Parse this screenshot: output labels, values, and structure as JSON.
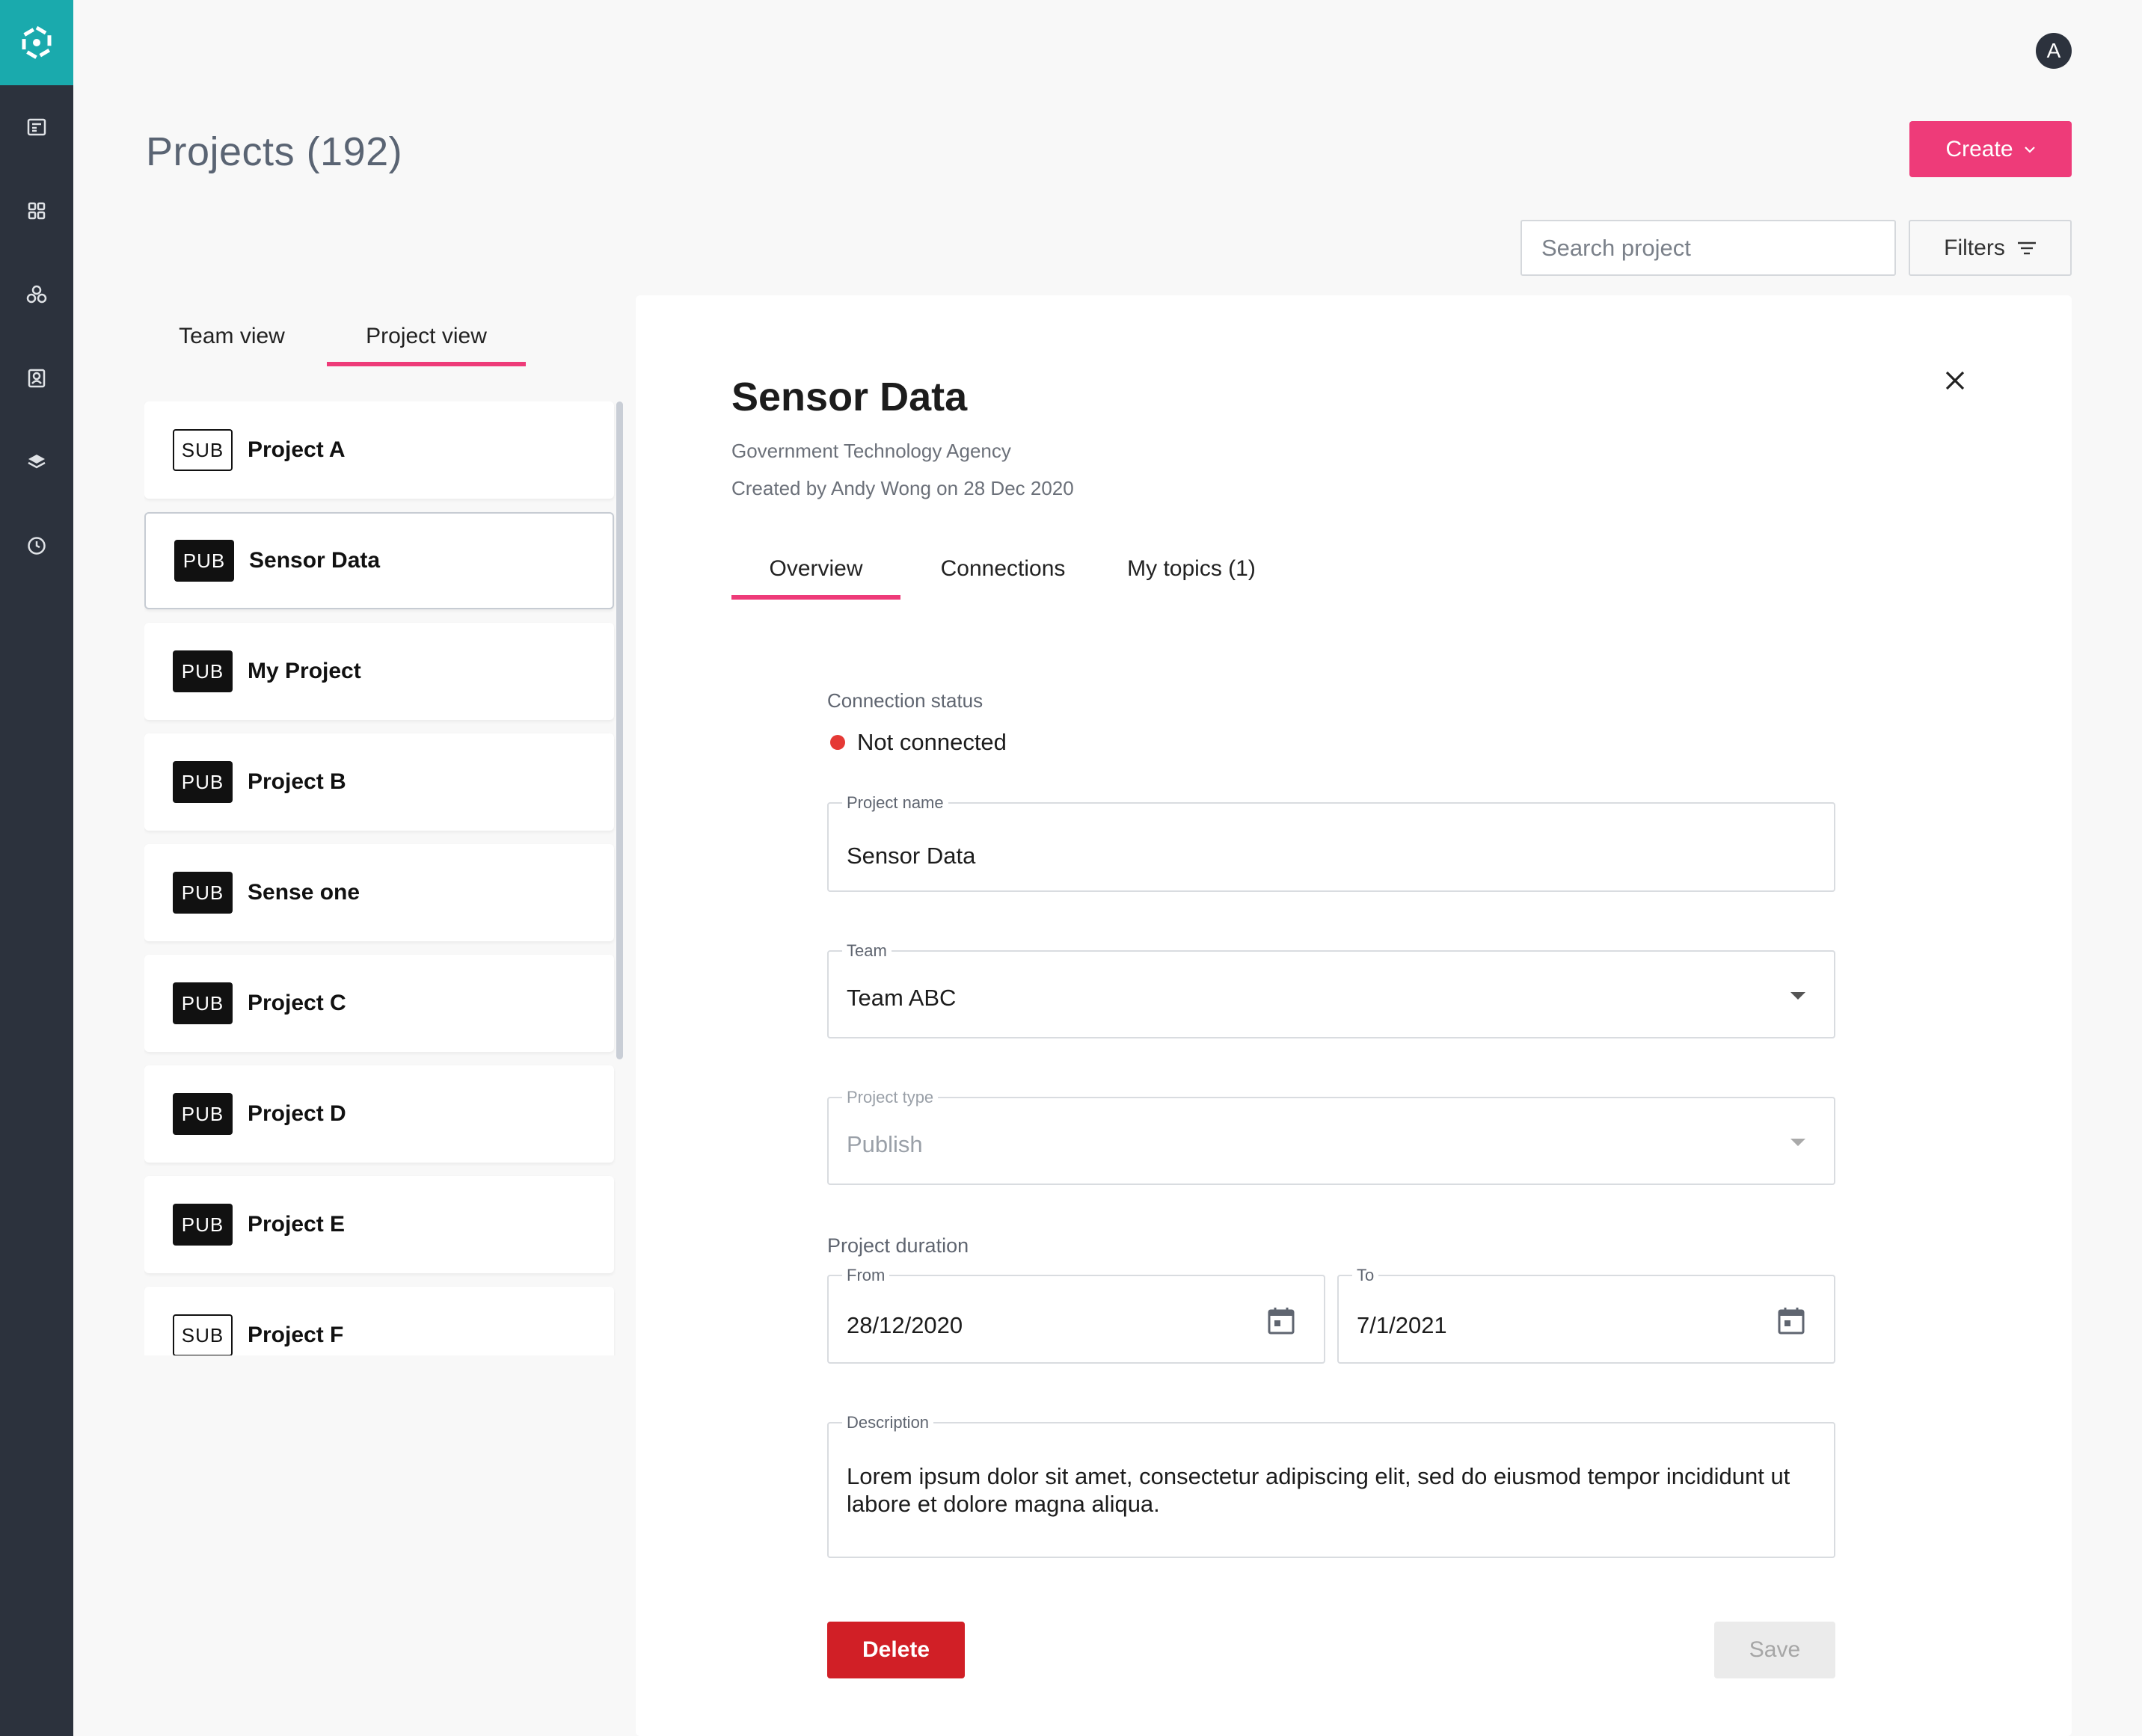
{
  "header": {
    "avatar_initial": "A",
    "page_title": "Projects (192)",
    "create_label": "Create",
    "search_placeholder": "Search project",
    "filters_label": "Filters"
  },
  "sidebar": {
    "items": [
      {
        "icon": "news-icon"
      },
      {
        "icon": "grid-icon"
      },
      {
        "icon": "network-icon"
      },
      {
        "icon": "contact-icon"
      },
      {
        "icon": "layers-icon"
      },
      {
        "icon": "clock-icon"
      }
    ]
  },
  "view_tabs": [
    {
      "label": "Team view",
      "active": false
    },
    {
      "label": "Project view",
      "active": true
    }
  ],
  "projects": [
    {
      "type": "SUB",
      "name": "Project A"
    },
    {
      "type": "PUB",
      "name": "Sensor Data",
      "selected": true
    },
    {
      "type": "PUB",
      "name": "My Project"
    },
    {
      "type": "PUB",
      "name": "Project B"
    },
    {
      "type": "PUB",
      "name": "Sense one"
    },
    {
      "type": "PUB",
      "name": "Project C"
    },
    {
      "type": "PUB",
      "name": "Project D"
    },
    {
      "type": "PUB",
      "name": "Project E"
    },
    {
      "type": "SUB",
      "name": "Project F"
    }
  ],
  "detail": {
    "title": "Sensor Data",
    "agency": "Government Technology Agency",
    "created": "Created by Andy Wong on 28 Dec 2020",
    "tabs": [
      {
        "label": "Overview",
        "active": true
      },
      {
        "label": "Connections",
        "active": false
      },
      {
        "label": "My topics (1)",
        "active": false
      }
    ],
    "connection_status_label": "Connection status",
    "connection_status": "Not connected",
    "project_name_label": "Project name",
    "project_name": "Sensor Data",
    "team_label": "Team",
    "team": "Team ABC",
    "project_type_label": "Project type",
    "project_type": "Publish",
    "duration_label": "Project duration",
    "from_label": "From",
    "from": "28/12/2020",
    "to_label": "To",
    "to": "7/1/2021",
    "description_label": "Description",
    "description": "Lorem ipsum dolor sit amet, consectetur adipiscing elit, sed do eiusmod tempor incididunt ut labore et dolore magna aliqua.",
    "delete_label": "Delete",
    "save_label": "Save"
  },
  "colors": {
    "accent": "#ee3b79",
    "sidebar": "#2c323d",
    "logo_bg": "#1aaaad",
    "danger": "#d11f26",
    "status_dot": "#e53935"
  }
}
